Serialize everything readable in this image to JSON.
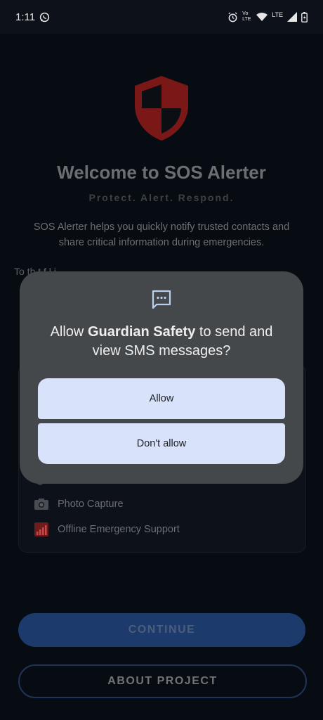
{
  "status_bar": {
    "time": "1:11",
    "network_label": "LTE",
    "volte_label": "Vo LTE"
  },
  "welcome": {
    "title": "Welcome to SOS Alerter",
    "tagline": "Protect. Alert. Respond.",
    "description": "SOS Alerter helps you quickly notify trusted contacts and share critical information during emergencies.",
    "partial_text": "To        th                                          t         f                                  l  i      "
  },
  "features": [
    {
      "icon": "camera-icon",
      "label": "Photo Capture"
    },
    {
      "icon": "signal-bars-icon",
      "label": "Offline Emergency Support"
    }
  ],
  "buttons": {
    "continue_label": "CONTINUE",
    "about_label": "ABOUT PROJECT"
  },
  "permission_dialog": {
    "icon": "sms-icon",
    "title_prefix": "Allow ",
    "app_name": "Guardian Safety",
    "title_suffix": " to send and view SMS messages?",
    "allow_label": "Allow",
    "deny_label": "Don't allow"
  },
  "colors": {
    "background": "#070b12",
    "dialog": "#45484b",
    "dialog_button": "#d8e2fb",
    "continue_button": "#1d3a6d",
    "shield": "#7a1717"
  }
}
